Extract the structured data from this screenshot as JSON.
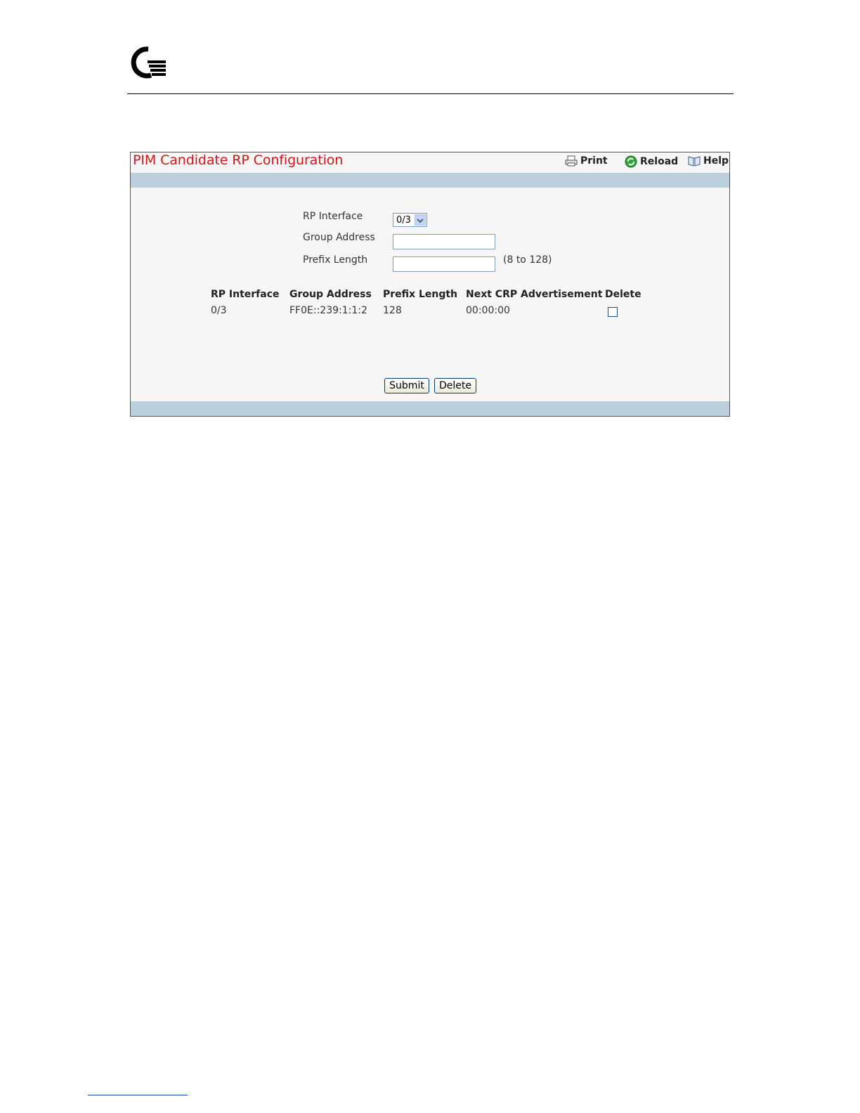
{
  "toolbar": {
    "print_label": "Print",
    "reload_label": "Reload",
    "help_label": "Help"
  },
  "page_title": "PIM Candidate RP Configuration",
  "form": {
    "rp_interface_label": "RP Interface",
    "rp_interface_value": "0/3",
    "group_address_label": "Group Address",
    "group_address_value": "",
    "prefix_length_label": "Prefix Length",
    "prefix_length_value": "",
    "prefix_length_hint": "(8 to 128)"
  },
  "table": {
    "headers": [
      "RP Interface",
      "Group Address",
      "Prefix Length",
      "Next CRP Advertisement",
      "Delete"
    ],
    "rows": [
      {
        "rp_interface": "0/3",
        "group_address": "FF0E::239:1:1:2",
        "prefix_length": "128",
        "next_crp_advertisement": "00:00:00",
        "delete": false
      }
    ]
  },
  "buttons": {
    "submit_label": "Submit",
    "delete_label": "Delete"
  },
  "colors": {
    "title": "#d4141a",
    "band": "#bccfdd",
    "panel_bg": "#f6f6f6"
  },
  "icons": {
    "print": "printer-icon",
    "reload": "reload-icon",
    "help": "help-book-icon",
    "logo": "brand-logo-icon"
  }
}
